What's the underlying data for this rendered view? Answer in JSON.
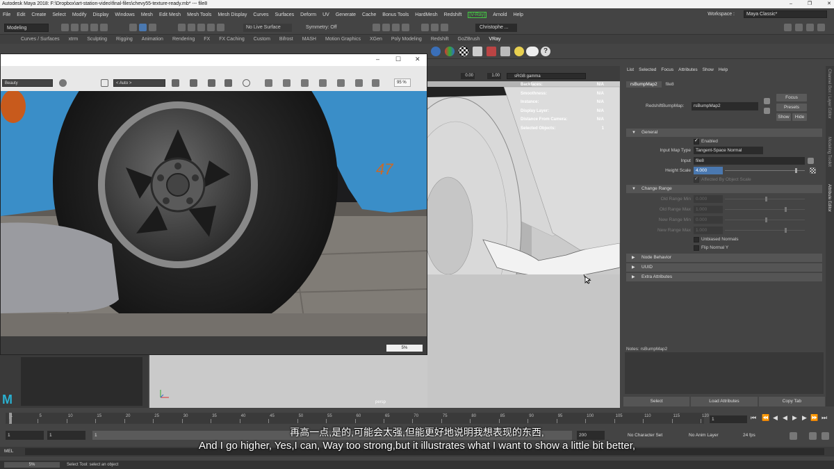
{
  "window": {
    "title": "Autodesk Maya 2018: F:\\Dropbox\\art-station-video\\final-files\\chevy55-texture-ready.mb*   ---   file8",
    "controls": [
      "–",
      "❐",
      "✕"
    ]
  },
  "menubar": {
    "items": [
      "File",
      "Edit",
      "Create",
      "Select",
      "Modify",
      "Display",
      "Windows",
      "Mesh",
      "Edit Mesh",
      "Mesh Tools",
      "Mesh Display",
      "Curves",
      "Surfaces",
      "Deform",
      "UV",
      "Generate",
      "Cache",
      "Bonus Tools",
      "HardMesh",
      "Redshift",
      "[V-Ray]",
      "Arnold",
      "Help"
    ],
    "workspace_label": "Workspace :",
    "workspace_value": "Maya Classic*"
  },
  "statusline": {
    "menuset": "Modeling",
    "live_surface": "No Live Surface",
    "symmetry": "Symmetry: Off",
    "user": "Christophe ..."
  },
  "shelf": {
    "tabs": [
      "Curves / Surfaces",
      "xtrm",
      "Sculpting",
      "Rigging",
      "Animation",
      "Rendering",
      "FX",
      "FX Caching",
      "Custom",
      "Bifrost",
      "MASH",
      "Motion Graphics",
      "XGen",
      "Poly Modeling",
      "Redshift",
      "GoZBrush",
      "VRay"
    ],
    "active": "VRay"
  },
  "render_view": {
    "aov": "Beauty",
    "snapshot": "< Auto >",
    "zoom": "95 %",
    "progress": "5%",
    "progress_value": 0.05,
    "controls": [
      "–",
      "☐",
      "✕"
    ]
  },
  "viewport": {
    "exposure": "0.00",
    "gamma": "1.00",
    "color_space": "sRGB gamma",
    "camera": "persp",
    "hud": [
      {
        "label": "Backfaces:",
        "value": "N/A"
      },
      {
        "label": "Smoothness:",
        "value": "N/A"
      },
      {
        "label": "Instance:",
        "value": "N/A"
      },
      {
        "label": "Display Layer:",
        "value": "N/A"
      },
      {
        "label": "Distance From Camera:",
        "value": "N/A"
      },
      {
        "label": "Selected Objects:",
        "value": "1"
      }
    ]
  },
  "attribute_editor": {
    "menu": [
      "List",
      "Selected",
      "Focus",
      "Attributes",
      "Show",
      "Help"
    ],
    "tabs": [
      "rsBumpMap2",
      "file8"
    ],
    "node_label": "RedshiftBumpMap:",
    "node_name": "rsBumpMap2",
    "focus": "Focus",
    "presets": "Presets",
    "show": "Show",
    "hide": "Hide",
    "general": {
      "title": "General",
      "enabled_label": "Enabled",
      "input_map_type_label": "Input Map Type",
      "input_map_type": "Tangent-Space Normal",
      "input_label": "Input",
      "input": "file8",
      "height_scale_label": "Height Scale",
      "height_scale": "4.000",
      "height_scale_slider": 0.88,
      "affected_label": "Affected By Object Scale"
    },
    "change_range": {
      "title": "Change Range",
      "rows": [
        {
          "label": "Old Range Min",
          "value": "0.000",
          "slider": 0.5
        },
        {
          "label": "Old Range Max",
          "value": "1.000",
          "slider": 0.75
        },
        {
          "label": "New Range Min",
          "value": "0.000",
          "slider": 0.5
        },
        {
          "label": "New Range Max",
          "value": "1.000",
          "slider": 0.75
        }
      ],
      "unbiased": "Unbiased Normals",
      "flip": "Flip Normal Y"
    },
    "sections": [
      "Node Behavior",
      "UUID",
      "Extra Attributes"
    ],
    "notes": "Notes:  rsBumpMap2",
    "buttons": [
      "Select",
      "Load Attributes",
      "Copy Tab"
    ]
  },
  "side_tabs": [
    "Channel Box / Layer Editor",
    "Modeling Toolkit",
    "Attribute Editor"
  ],
  "timeline": {
    "labels": [
      "1",
      "5",
      "10",
      "15",
      "20",
      "25",
      "30",
      "35",
      "40",
      "45",
      "50",
      "55",
      "60",
      "65",
      "70",
      "75",
      "80",
      "85",
      "90",
      "95",
      "100",
      "105",
      "110",
      "115",
      "120"
    ],
    "current_frame": "1"
  },
  "range": {
    "start": "1",
    "anim_start": "1",
    "range_start": "1",
    "range_end": "200",
    "character_set": "No Character Set",
    "anim_layer": "No Anim Layer",
    "fps": "24 fps"
  },
  "command": {
    "lang": "MEL",
    "help_progress": "5%",
    "help_text": "Select Tool: select an object"
  },
  "subtitles": {
    "cn": "再高一点,是的,可能会太强,但能更好地说明我想表现的东西,",
    "en": "And I go higher, Yes,I can, Way too strong,but it illustrates what I want to show a little bit better,"
  },
  "colors": {
    "accent": "#4a78b0",
    "maya_logo": "#2ab0d0",
    "vray": "#44cc44",
    "car_paint": "#3a8ec8"
  }
}
